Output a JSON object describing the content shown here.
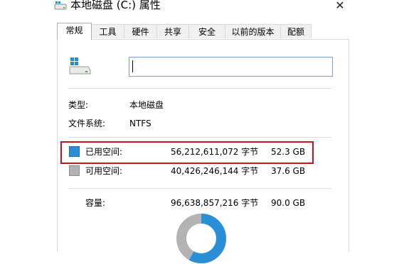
{
  "window": {
    "title": "本地磁盘 (C:) 属性",
    "close_symbol": "✕",
    "title_icon": "drive-icon"
  },
  "tabs": [
    {
      "label": "常规",
      "active": true
    },
    {
      "label": "工具",
      "active": false
    },
    {
      "label": "硬件",
      "active": false
    },
    {
      "label": "共享",
      "active": false
    },
    {
      "label": "安全",
      "active": false
    },
    {
      "label": "以前的版本",
      "active": false
    },
    {
      "label": "配额",
      "active": false
    }
  ],
  "general": {
    "drive_icon": "windows-drive-icon",
    "name_value": "",
    "type_label": "类型:",
    "type_value": "本地磁盘",
    "fs_label": "文件系统:",
    "fs_value": "NTFS"
  },
  "space": {
    "used": {
      "label": "已用空间:",
      "bytes": "56,212,611,072 字节",
      "size": "52.3 GB",
      "color": "#2b8fd8"
    },
    "free": {
      "label": "可用空间:",
      "bytes": "40,426,246,144 字节",
      "size": "37.6 GB",
      "color": "#b3b3b3"
    },
    "capacity": {
      "label": "容量:",
      "bytes": "96,638,857,216 字节",
      "size": "90.0 GB"
    }
  },
  "colors": {
    "highlight": "#c9141e",
    "used": "#2b8fd8",
    "free": "#b3b3b3"
  },
  "usage_fraction": 0.581
}
